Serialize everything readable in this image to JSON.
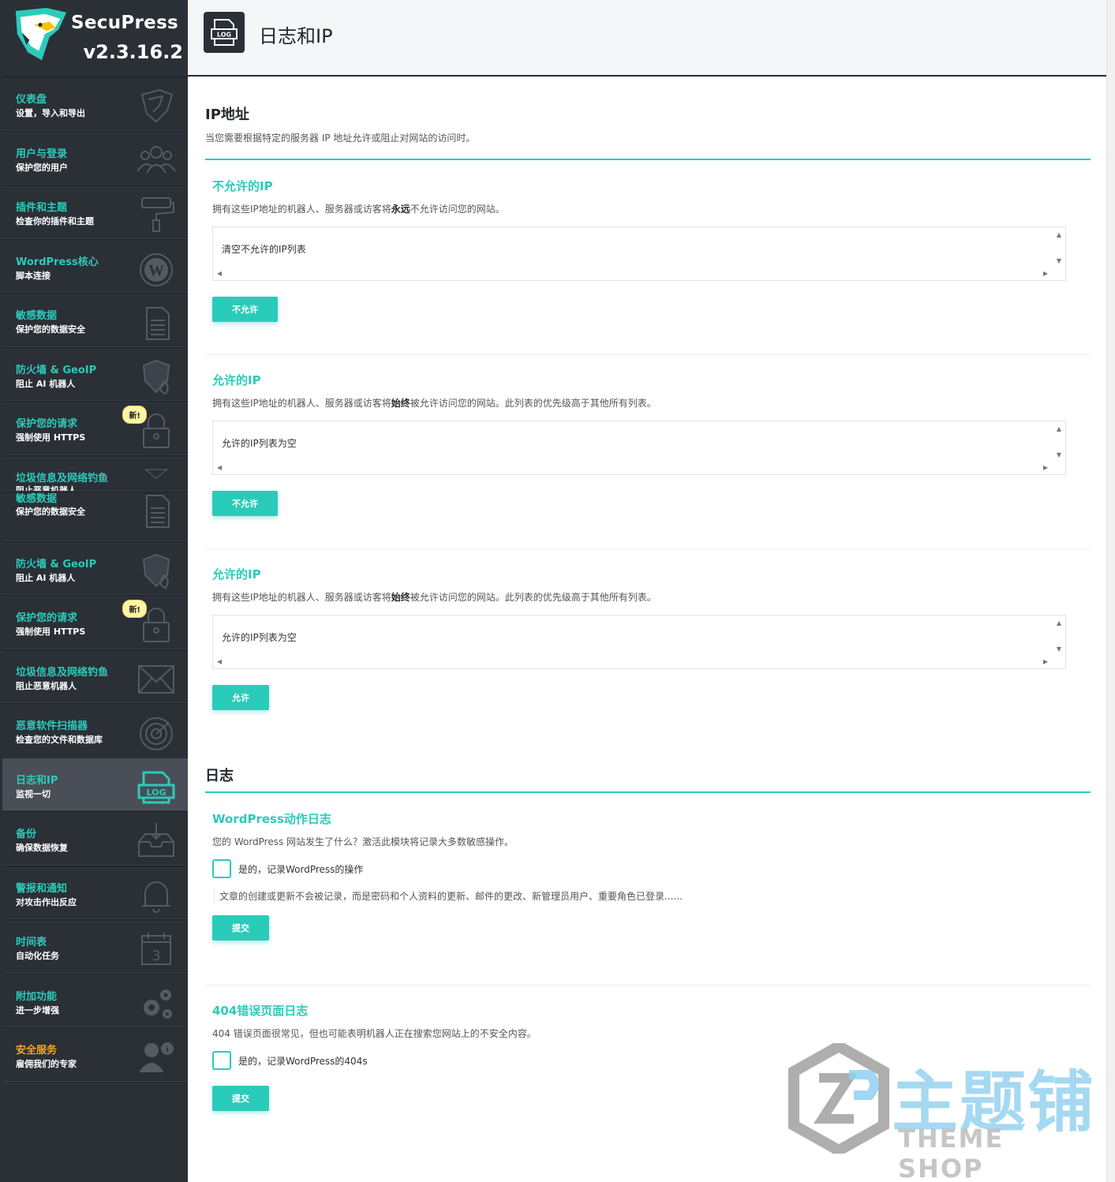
{
  "brand": {
    "name": "SecuPress",
    "version": "v2.3.16.2"
  },
  "page": {
    "title": "日志和IP",
    "header_icon": "log-file-icon"
  },
  "sidebar": {
    "items": [
      {
        "title": "仪表盘",
        "subtitle": "设置，导入和导出",
        "icon": "shield-dashboard-icon"
      },
      {
        "title": "用户与登录",
        "subtitle": "保护您的用户",
        "icon": "users-icon"
      },
      {
        "title": "插件和主题",
        "subtitle": "检查你的插件和主题",
        "icon": "paint-roller-icon"
      },
      {
        "title": "WordPress核心",
        "subtitle": "脚本连接",
        "icon": "wordpress-icon"
      },
      {
        "title": "敏感数据",
        "subtitle": "保护您的数据安全",
        "icon": "document-icon"
      },
      {
        "title": "防火墙 & GeoIP",
        "subtitle": "阻止 AI 机器人",
        "icon": "firewall-shield-icon"
      },
      {
        "title": "保护您的请求",
        "subtitle": "强制使用 HTTPS",
        "icon": "padlock-icon",
        "badge": "新!"
      },
      {
        "title": "垃圾信息及网络钓鱼",
        "subtitle": "阻止恶意机器人",
        "icon": "envelope-icon"
      },
      {
        "title": "敏感数据",
        "subtitle": "保护您的数据安全",
        "icon": "document-icon"
      },
      {
        "title": "防火墙 & GeoIP",
        "subtitle": "阻止 AI 机器人",
        "icon": "firewall-shield-icon"
      },
      {
        "title": "保护您的请求",
        "subtitle": "强制使用 HTTPS",
        "icon": "padlock-icon",
        "badge": "新!"
      },
      {
        "title": "垃圾信息及网络钓鱼",
        "subtitle": "阻止恶意机器人",
        "icon": "envelope-icon"
      },
      {
        "title": "恶意软件扫描器",
        "subtitle": "检查您的文件和数据库",
        "icon": "radar-icon"
      },
      {
        "title": "日志和IP",
        "subtitle": "监视一切",
        "icon": "log-file-icon",
        "active": true
      },
      {
        "title": "备份",
        "subtitle": "确保数据恢复",
        "icon": "inbox-download-icon"
      },
      {
        "title": "警报和通知",
        "subtitle": "对攻击作出反应",
        "icon": "bell-icon"
      },
      {
        "title": "时间表",
        "subtitle": "自动化任务",
        "icon": "calendar-icon",
        "calendar_day": "3"
      },
      {
        "title": "附加功能",
        "subtitle": "进一步增强",
        "icon": "gears-icon"
      },
      {
        "title": "安全服务",
        "subtitle": "雇佣我们的专家",
        "icon": "expert-user-icon"
      }
    ]
  },
  "ip_section": {
    "title": "IP地址",
    "description": "当您需要根据特定的服务器 IP 地址允许或阻止对网站的访问时。",
    "blocks": [
      {
        "title": "不允许的IP",
        "desc_pre": "拥有这些IP地址的机器人、服务器或访客将",
        "desc_bold": "永远",
        "desc_post": "不允许访问您的网站。",
        "list_text": "清空不允许的IP列表",
        "button": "不允许"
      },
      {
        "title": "允许的IP",
        "desc_pre": "拥有这些IP地址的机器人、服务器或访客将",
        "desc_bold": "始终",
        "desc_post": "被允许访问您的网站。此列表的优先级高于其他所有列表。",
        "list_text": "允许的IP列表为空",
        "button": "不允许"
      },
      {
        "title": "允许的IP",
        "desc_pre": "拥有这些IP地址的机器人、服务器或访客将",
        "desc_bold": "始终",
        "desc_post": "被允许访问您的网站。此列表的优先级高于其他所有列表。",
        "list_text": "允许的IP列表为空",
        "button": "允许"
      }
    ]
  },
  "log_section": {
    "title": "日志",
    "wp_actions": {
      "title": "WordPress动作日志",
      "description": "您的 WordPress 网站发生了什么？激活此模块将记录大多数敏感操作。",
      "checkbox_label": "是的，记录WordPress的操作",
      "note": "文章的创建或更新不会被记录，而是密码和个人资料的更新、邮件的更改、新管理员用户、重要角色已登录......",
      "button": "提交"
    },
    "error_404": {
      "title": "404错误页面日志",
      "description": "404 错误页面很常见，但也可能表明机器人正在搜索您网站上的不安全内容。",
      "checkbox_label": "是的，记录WordPress的404s",
      "button": "提交"
    }
  },
  "watermark": {
    "cn": "主题铺",
    "en": "THEME SHOP"
  },
  "colors": {
    "accent": "#2bcbba",
    "sidebar_bg": "#2b2f36",
    "orange": "#f5a623",
    "badge": "#fff4a3"
  }
}
